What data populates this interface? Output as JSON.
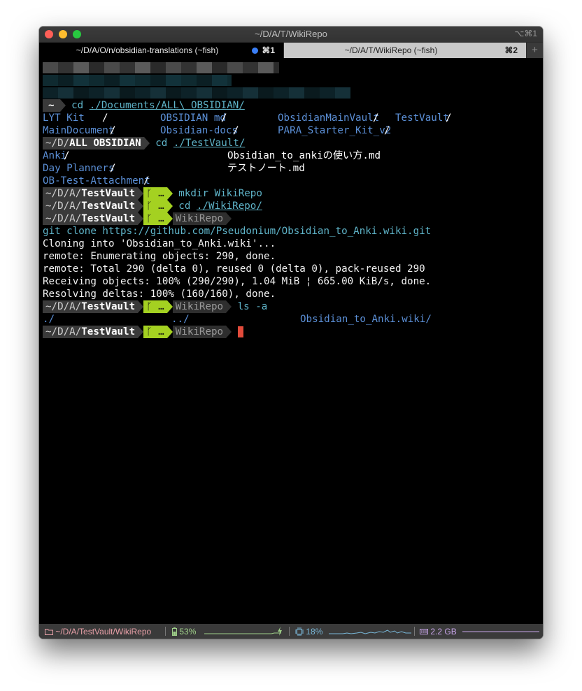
{
  "window": {
    "title": "~/D/A/T/WikiRepo",
    "title_shortcut": "⌥⌘1"
  },
  "tabs": [
    {
      "label": "~/D/A/O/n/obsidian-translations (~fish)",
      "shortcut": "⌘1",
      "active": true
    },
    {
      "label": "~/D/A/T/WikiRepo (~fish)",
      "shortcut": "⌘2",
      "active": false
    }
  ],
  "newtab_label": "+",
  "terminal": {
    "home_prompt": "~",
    "cmd1": {
      "cmd": "cd",
      "arg": "./Documents/ALL\\ OBSIDIAN/"
    },
    "ls1": {
      "col1": [
        "LYT Kit",
        "MainDocument"
      ],
      "col2": [
        "OBSIDIAN md",
        "Obsidian-docs"
      ],
      "col3": [
        "ObsidianMainVault",
        "PARA_Starter_Kit_v2"
      ],
      "col4": [
        "TestVault",
        ""
      ]
    },
    "prompt2": {
      "dir_prefix": "~/D/",
      "dir_bold": "ALL OBSIDIAN",
      "cmd": "cd",
      "arg": "./TestVault/"
    },
    "ls2": {
      "dirs": [
        "Anki",
        "Day Planners",
        "OB-Test-Attachment"
      ],
      "files": [
        "Obsidian_to_ankiの使い方.md",
        "テストノート.md"
      ]
    },
    "vault_prompt": {
      "dir_prefix": "~/D/A/",
      "dir_bold": "TestVault",
      "git": "ᚴ …"
    },
    "mkdir": {
      "cmd": "mkdir",
      "arg": "WikiRepo"
    },
    "cd_wiki": {
      "cmd": "cd",
      "arg": "./WikiRepo/"
    },
    "repo_label": "WikiRepo",
    "clone": {
      "cmd": "git clone",
      "arg": "https://github.com/Pseudonium/Obsidian_to_Anki.wiki.git"
    },
    "clone_output": [
      "Cloning into 'Obsidian_to_Anki.wiki'...",
      "remote: Enumerating objects: 290, done.",
      "remote: Total 290 (delta 0), reused 0 (delta 0), pack-reused 290",
      "Receiving objects: 100% (290/290), 1.04 MiB ¦ 665.00 KiB/s, done.",
      "Resolving deltas: 100% (160/160), done."
    ],
    "ls_cmd": {
      "cmd": "ls",
      "arg": "-a"
    },
    "ls3": [
      "./",
      "../",
      "Obsidian_to_Anki.wiki/"
    ],
    "slash": "/"
  },
  "statusbar": {
    "path": "~/D/A/TestVault/WikiRepo",
    "battery": "53%",
    "cpu": "18%",
    "memory": "2.2 GB"
  },
  "colors": {
    "prompt_bg": "#3a3a3a",
    "git_segment": "#a4d121",
    "command": "#5fb4c9",
    "directory": "#5b8fd6",
    "cursor": "#e24b3b"
  }
}
